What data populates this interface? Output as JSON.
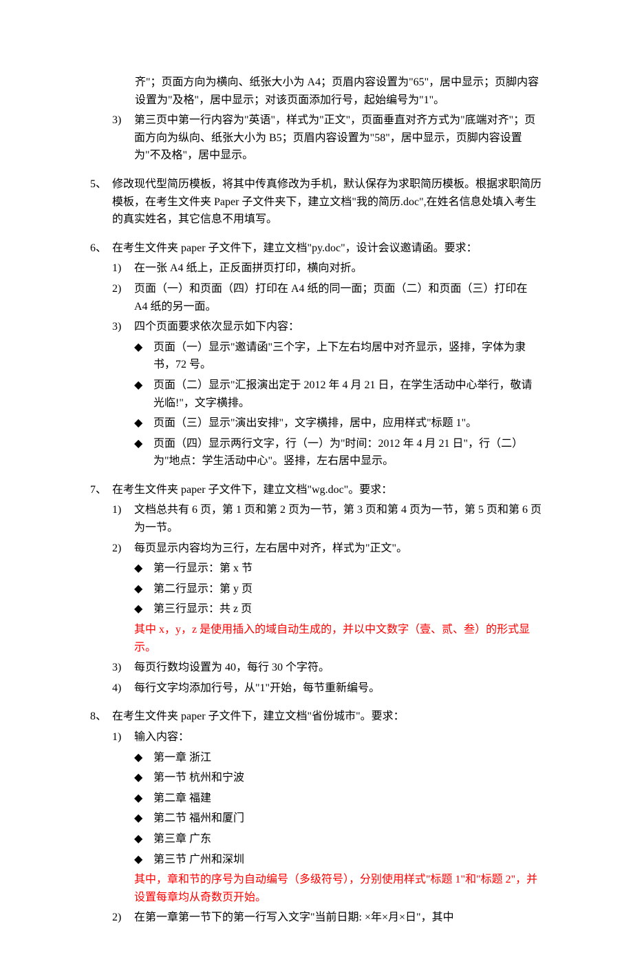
{
  "preamble": {
    "cont1": "齐\"；页面方向为横向、纸张大小为 A4；页眉内容设置为\"65\"，居中显示；页脚内容设置为\"及格\"，居中显示；对该页面添加行号，起始编号为\"1\"。",
    "sub3_num": "3)",
    "sub3": "第三页中第一行内容为\"英语\"，样式为\"正文\"，页面垂直对齐方式为\"底端对齐\"；页面方向为纵向、纸张大小为 B5；页眉内容设置为\"58\"，居中显示，页脚内容设置为\"不及格\"，居中显示。"
  },
  "q5": {
    "num": "5、",
    "text": "修改现代型简历模板，将其中传真修改为手机，默认保存为求职简历模板。根据求职简历模板，在考生文件夹 Paper 子文件夹下，建立文档\"我的简历.doc\",在姓名信息处填入考生的真实姓名，其它信息不用填写。"
  },
  "q6": {
    "num": "6、",
    "text": "在考生文件夹 paper 子文件下，建立文档\"py.doc\"，设计会议邀请函。要求：",
    "items": [
      {
        "num": "1)",
        "text": "在一张 A4 纸上，正反面拼页打印，横向对折。"
      },
      {
        "num": "2)",
        "text": "页面（一）和页面（四）打印在 A4 纸的同一面；页面（二）和页面（三）打印在 A4 纸的另一面。"
      },
      {
        "num": "3)",
        "text": "四个页面要求依次显示如下内容："
      }
    ],
    "bullets": [
      "页面（一）显示\"邀请函\"三个字，上下左右均居中对齐显示，竖排，字体为隶书，72 号。",
      "页面（二）显示\"汇报演出定于 2012 年 4 月 21 日，在学生活动中心举行，敬请光临!\"，文字横排。",
      "页面（三）显示\"演出安排\"，文字横排，居中，应用样式\"标题 1\"。",
      "页面（四）显示两行文字，行（一）为\"时间：2012 年 4 月 21 日\"，行（二）为\"地点：学生活动中心\"。竖排，左右居中显示。"
    ]
  },
  "q7": {
    "num": "7、",
    "text": "在考生文件夹 paper 子文件下，建立文档\"wg.doc\"。要求：",
    "items": [
      {
        "num": "1)",
        "text": "文档总共有 6 页，第 1 页和第 2 页为一节，第 3 页和第 4 页为一节，第 5 页和第 6 页为一节。"
      },
      {
        "num": "2)",
        "text": "每页显示内容均为三行，左右居中对齐，样式为\"正文\"。"
      }
    ],
    "bullets2": [
      "第一行显示：第 x 节",
      "第二行显示：第 y 页",
      "第三行显示：共 z 页"
    ],
    "red2": "其中 x，y，z 是使用插入的域自动生成的，并以中文数字（壹、贰、叁）的形式显示。",
    "items_after": [
      {
        "num": "3)",
        "text": "每页行数均设置为 40，每行 30 个字符。"
      },
      {
        "num": "4)",
        "text": "每行文字均添加行号，从\"1\"开始，每节重新编号。"
      }
    ]
  },
  "q8": {
    "num": "8、",
    "text": "在考生文件夹 paper 子文件下，建立文档\"省份城市\"。要求：",
    "item1_num": "1)",
    "item1_text": "输入内容：",
    "bullets": [
      "第一章  浙江",
      "第一节  杭州和宁波",
      "第二章  福建",
      "第二节  福州和厦门",
      "第三章  广东",
      "第三节  广州和深圳"
    ],
    "red": "其中，章和节的序号为自动编号（多级符号），分别使用样式\"标题 1\"和\"标题 2\"，并设置每章均从奇数页开始。",
    "item2_num": "2)",
    "item2_text": "在第一章第一节下的第一行写入文字\"当前日期: ×年×月×日\"，其中"
  },
  "bullet_mark": "◆"
}
